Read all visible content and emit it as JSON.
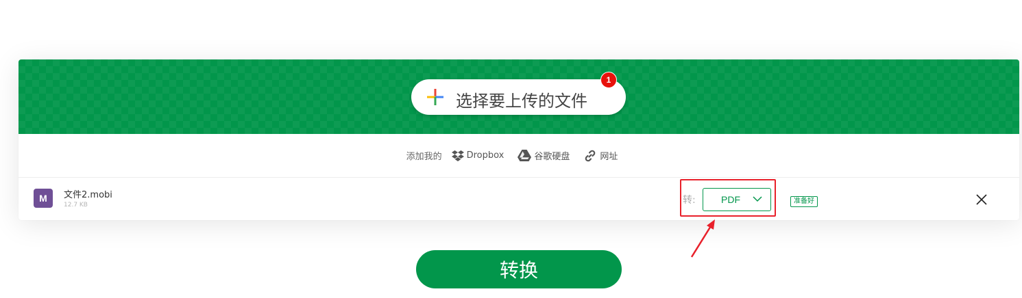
{
  "upload": {
    "choose_label": "选择要上传的文件",
    "badge_count": "1"
  },
  "sources": {
    "prefix": "添加我的",
    "items": [
      {
        "label": "Dropbox",
        "icon": "dropbox-icon"
      },
      {
        "label": "谷歌硬盘",
        "icon": "google-drive-icon"
      },
      {
        "label": "网址",
        "icon": "link-icon"
      }
    ]
  },
  "file": {
    "icon_letter": "M",
    "name": "文件2.mobi",
    "size": "12.7 KB",
    "convert_to_label": "转:",
    "format": "PDF",
    "status": "准备好"
  },
  "convert_button_label": "转换",
  "colors": {
    "brand_green": "#02964b",
    "badge_red": "#e8120c",
    "annotation_red": "#e8202a",
    "file_icon_purple": "#6f4f96"
  }
}
